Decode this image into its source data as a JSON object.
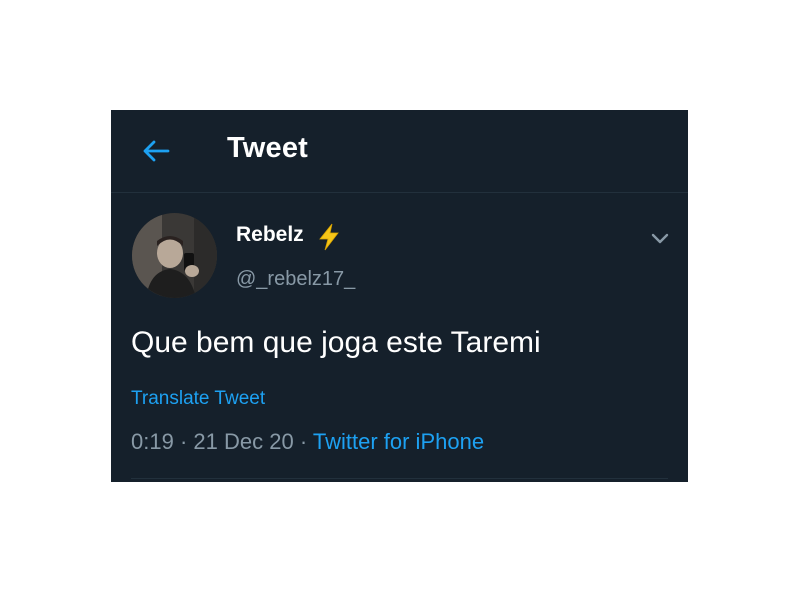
{
  "header": {
    "title": "Tweet",
    "back_icon": "arrow-left-icon"
  },
  "tweet": {
    "author": {
      "display_name": "Rebelz",
      "emoji_icon": "lightning-bolt-icon",
      "handle": "@_rebelz17_"
    },
    "text": "Que bem que joga este Taremi",
    "translate_label": "Translate Tweet",
    "time": "0:19",
    "separator_1": "·",
    "date": "21 Dec 20",
    "separator_2": "·",
    "source": "Twitter for iPhone"
  },
  "colors": {
    "background": "#15202b",
    "accent": "#1da1f2",
    "secondary_text": "#8899a6",
    "primary_text": "#ffffff",
    "bolt": "#f5c518"
  }
}
